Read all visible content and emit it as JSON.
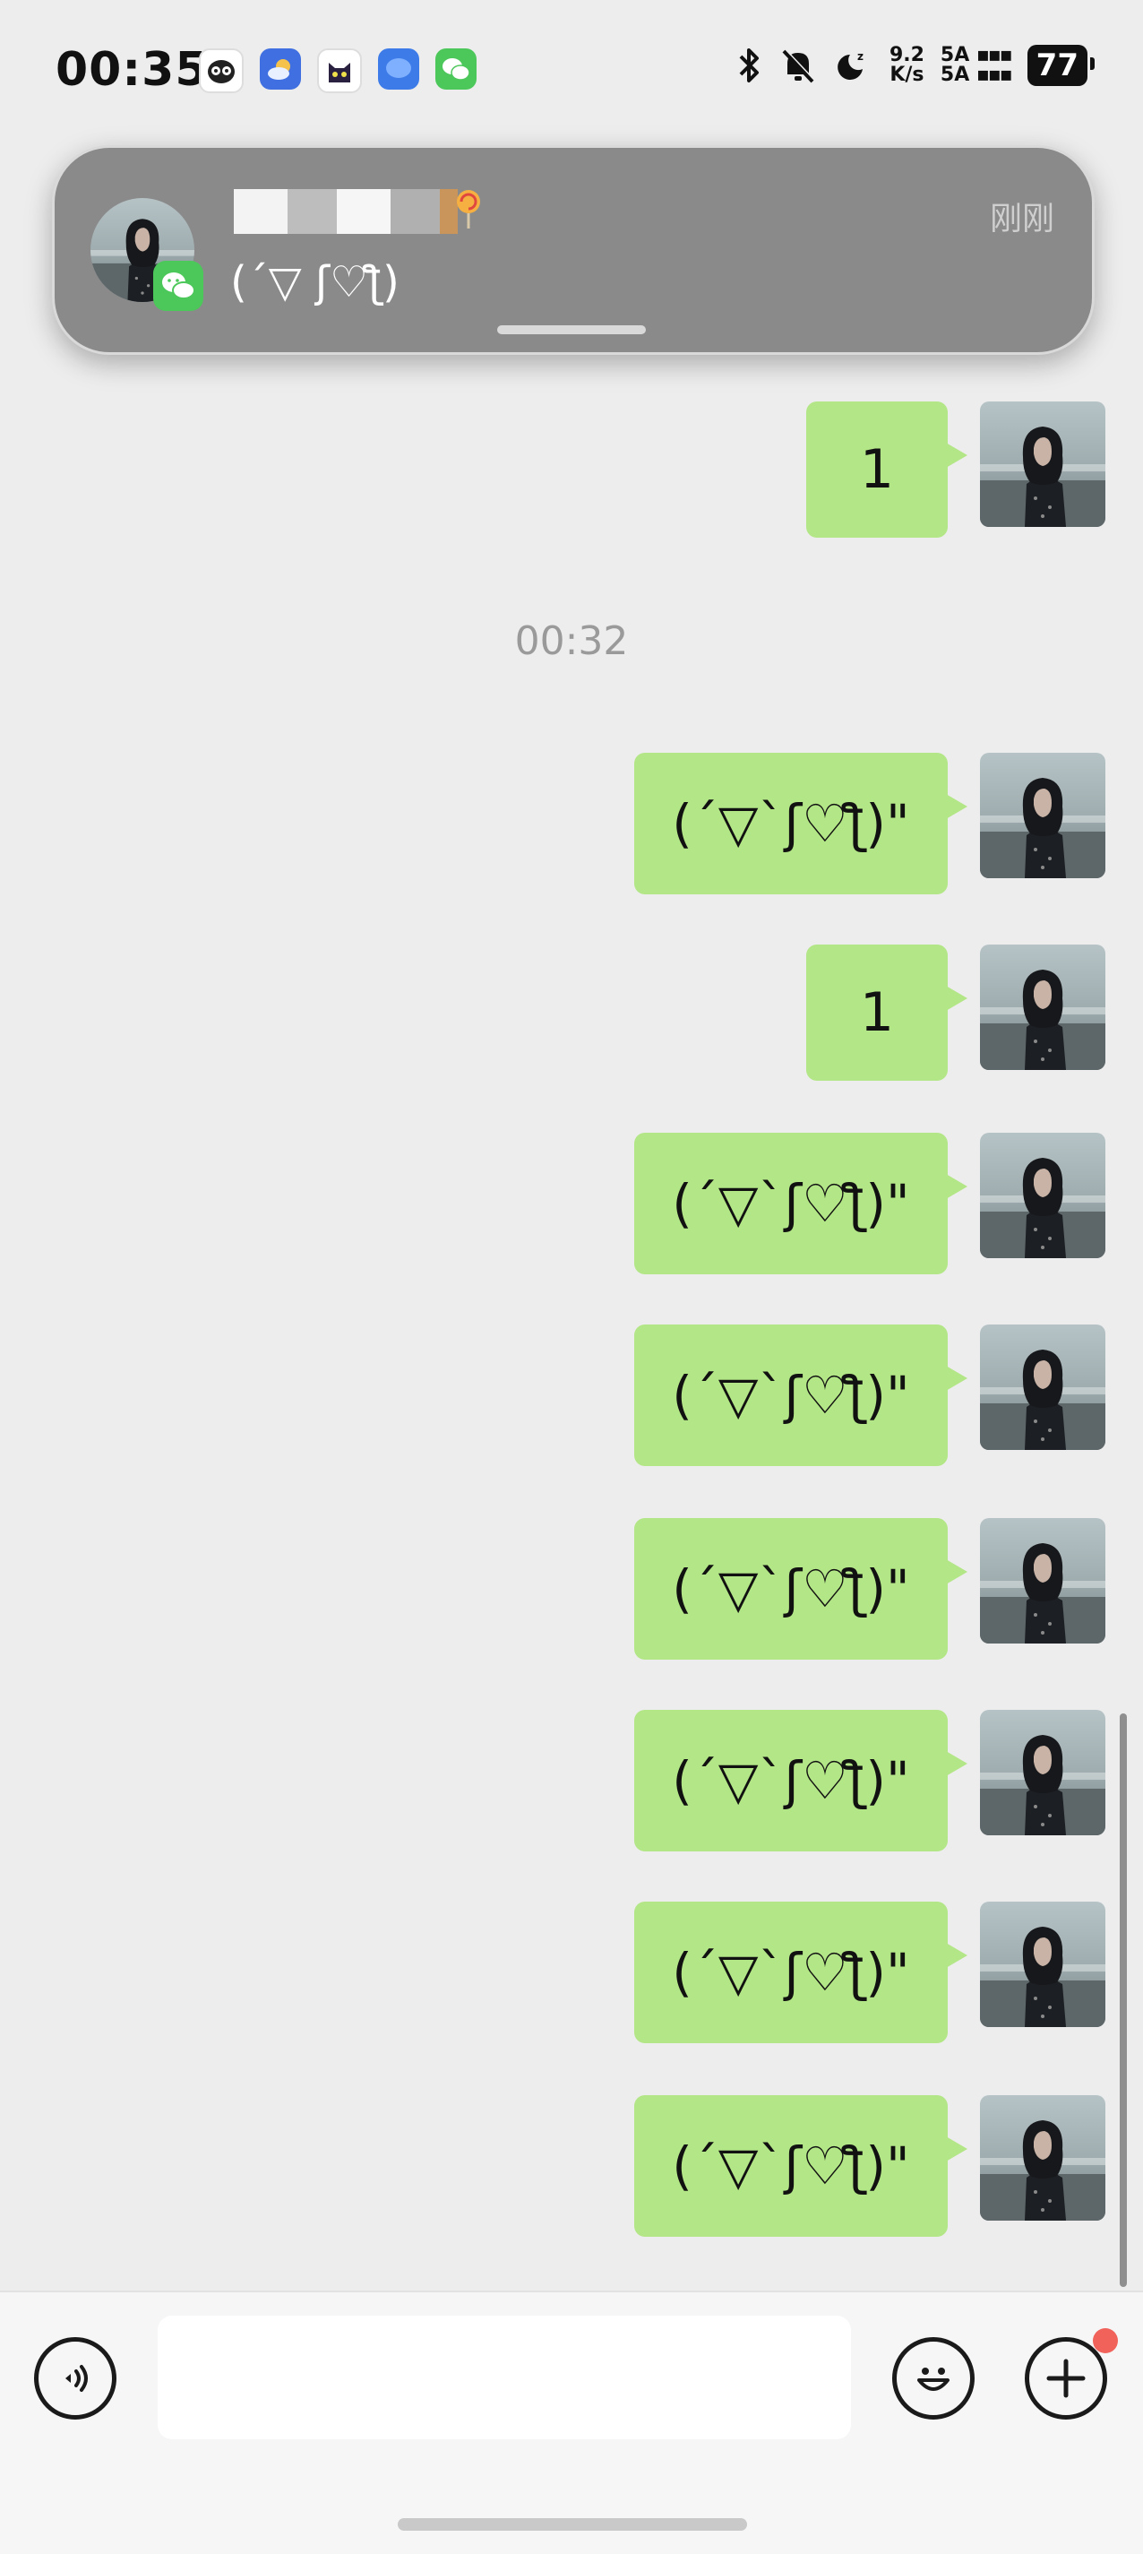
{
  "status_bar": {
    "time": "00:35",
    "app_icons": [
      "owl-app-icon",
      "weather-app-icon",
      "cat-app-icon",
      "messages-app-icon",
      "wechat-app-icon"
    ],
    "net_speed_value": "9.2",
    "net_speed_unit": "K/s",
    "signal_top": "5A",
    "signal_bottom": "5A",
    "battery": "77"
  },
  "notification": {
    "sender_icon": "wechat-icon",
    "message": "(´▽ ʃ♡ƪ)",
    "time": "刚刚"
  },
  "chat": {
    "timestamp": "00:32",
    "messages": [
      {
        "text": "1"
      },
      {
        "text": "(´▽`ʃ♡ƪ)\""
      },
      {
        "text": "1"
      },
      {
        "text": "(´▽`ʃ♡ƪ)\""
      },
      {
        "text": "(´▽`ʃ♡ƪ)\""
      },
      {
        "text": "(´▽`ʃ♡ƪ)\""
      },
      {
        "text": "(´▽`ʃ♡ƪ)\""
      },
      {
        "text": "(´▽`ʃ♡ƪ)\""
      },
      {
        "text": "(´▽`ʃ♡ƪ)\""
      }
    ]
  },
  "input_bar": {
    "placeholder": ""
  },
  "colors": {
    "background": "#ededed",
    "bubble": "#b3e686",
    "wechat_green": "#4cc75a",
    "notification": "#8a8a8a",
    "badge_red": "#f0625a"
  }
}
